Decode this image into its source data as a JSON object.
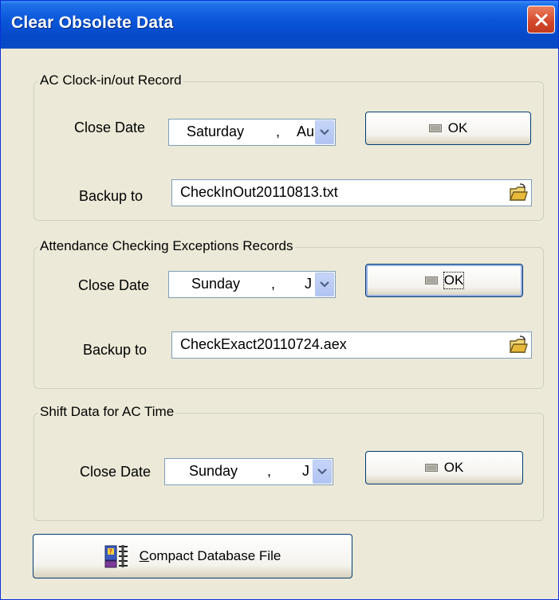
{
  "window": {
    "title": "Clear Obsolete Data"
  },
  "groups": [
    {
      "title": "AC Clock-in/out Record",
      "close_date_label": "Close Date",
      "date_day": "Saturday",
      "date_sep": ",",
      "date_clip": "Au",
      "ok_label": "OK",
      "ok_mnemonic": "K",
      "backup_label": "Backup to",
      "backup_file": "CheckInOut20110813.txt"
    },
    {
      "title": "Attendance Checking Exceptions Records",
      "close_date_label": "Close Date",
      "date_day": "Sunday",
      "date_sep": ",",
      "date_clip": "J",
      "ok_label": "OK",
      "backup_label": "Backup to",
      "backup_file": "CheckExact20110724.aex"
    },
    {
      "title": "Shift Data for AC Time",
      "close_date_label": "Close Date",
      "date_day": "Sunday",
      "date_sep": ",",
      "date_clip": "J",
      "ok_label": "OK"
    }
  ],
  "compact_button": {
    "label_first": "C",
    "label_rest": "ompact Database File"
  },
  "colors": {
    "title_bar": "#0A57DA",
    "dialog_bg": "#ECE9D8",
    "close_button": "#D2472A",
    "button_border": "#003C74"
  },
  "icons": [
    "close-icon",
    "chevron-down-icon",
    "ok-icon",
    "open-folder-icon",
    "compact-database-icon"
  ]
}
